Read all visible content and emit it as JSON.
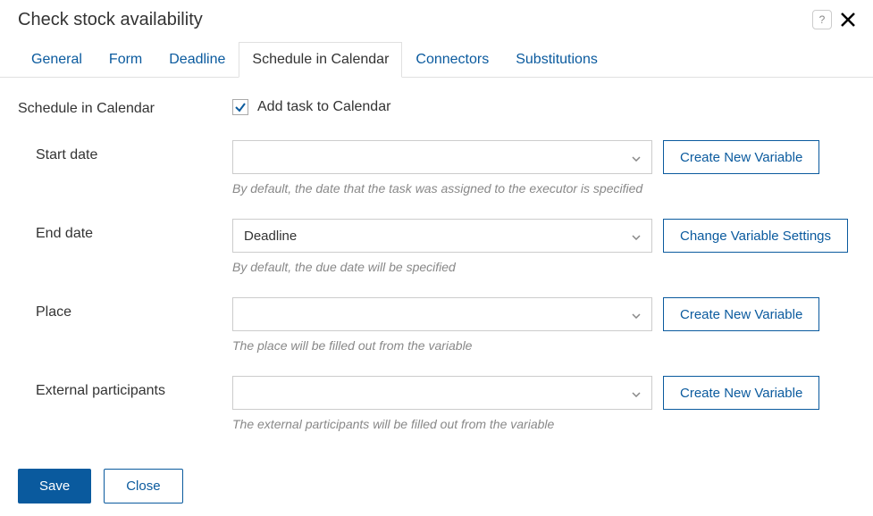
{
  "header": {
    "title": "Check stock availability",
    "help": "?"
  },
  "tabs": [
    {
      "label": "General",
      "active": false
    },
    {
      "label": "Form",
      "active": false
    },
    {
      "label": "Deadline",
      "active": false
    },
    {
      "label": "Schedule in Calendar",
      "active": true
    },
    {
      "label": "Connectors",
      "active": false
    },
    {
      "label": "Substitutions",
      "active": false
    }
  ],
  "section": {
    "title": "Schedule in Calendar",
    "checkbox_label": "Add task to Calendar",
    "checkbox_checked": true
  },
  "fields": {
    "start_date": {
      "label": "Start date",
      "value": "",
      "button": "Create New Variable",
      "help": "By default, the date that the task was assigned to the executor is specified"
    },
    "end_date": {
      "label": "End date",
      "value": "Deadline",
      "button": "Change Variable Settings",
      "help": "By default, the due date will be specified"
    },
    "place": {
      "label": "Place",
      "value": "",
      "button": "Create New Variable",
      "help": "The place will be filled out from the variable"
    },
    "external_participants": {
      "label": "External participants",
      "value": "",
      "button": "Create New Variable",
      "help": "The external participants will be filled out from the variable"
    }
  },
  "footer": {
    "save": "Save",
    "close": "Close"
  }
}
